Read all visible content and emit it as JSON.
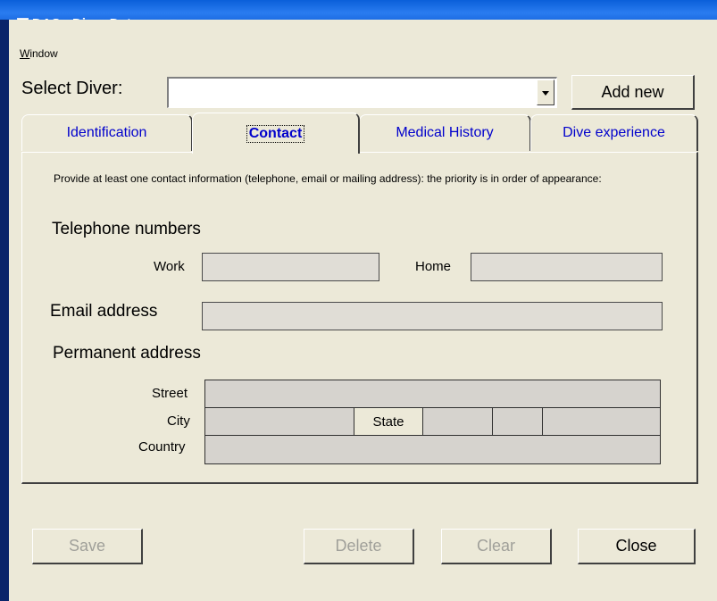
{
  "window": {
    "title": "DAS - Diver Data",
    "controls": [
      "minimize-icon",
      "maximize-icon",
      "close-icon"
    ]
  },
  "menu": {
    "items": [
      {
        "label": "Window",
        "mnemonic": "W"
      }
    ]
  },
  "select_diver": {
    "label": "Select Diver:",
    "value": "",
    "add_new_label": "Add new"
  },
  "tabs": [
    {
      "label": "Identification",
      "active": false
    },
    {
      "label": "Contact",
      "active": true
    },
    {
      "label": "Medical History",
      "active": false
    },
    {
      "label": "Dive experience",
      "active": false
    }
  ],
  "contact": {
    "instructions": "Provide at least one contact information (telephone, email or mailing address): the priority is in order of appearance:",
    "telephone_heading": "Telephone numbers",
    "work_label": "Work",
    "work_value": "",
    "home_label": "Home",
    "home_value": "",
    "email_heading": "Email address",
    "email_value": "",
    "address_heading": "Permanent address",
    "street_label": "Street",
    "city_label": "City",
    "state_label": "State",
    "country_label": "Country"
  },
  "buttons": {
    "save": "Save",
    "delete": "Delete",
    "clear": "Clear",
    "close": "Close"
  },
  "colors": {
    "window_face": "#ece9d8",
    "titlebar": "#0a5fd9",
    "tab_text": "#0000cc",
    "field_bg": "#e0ddd6",
    "disabled_text": "#a0a09a"
  }
}
